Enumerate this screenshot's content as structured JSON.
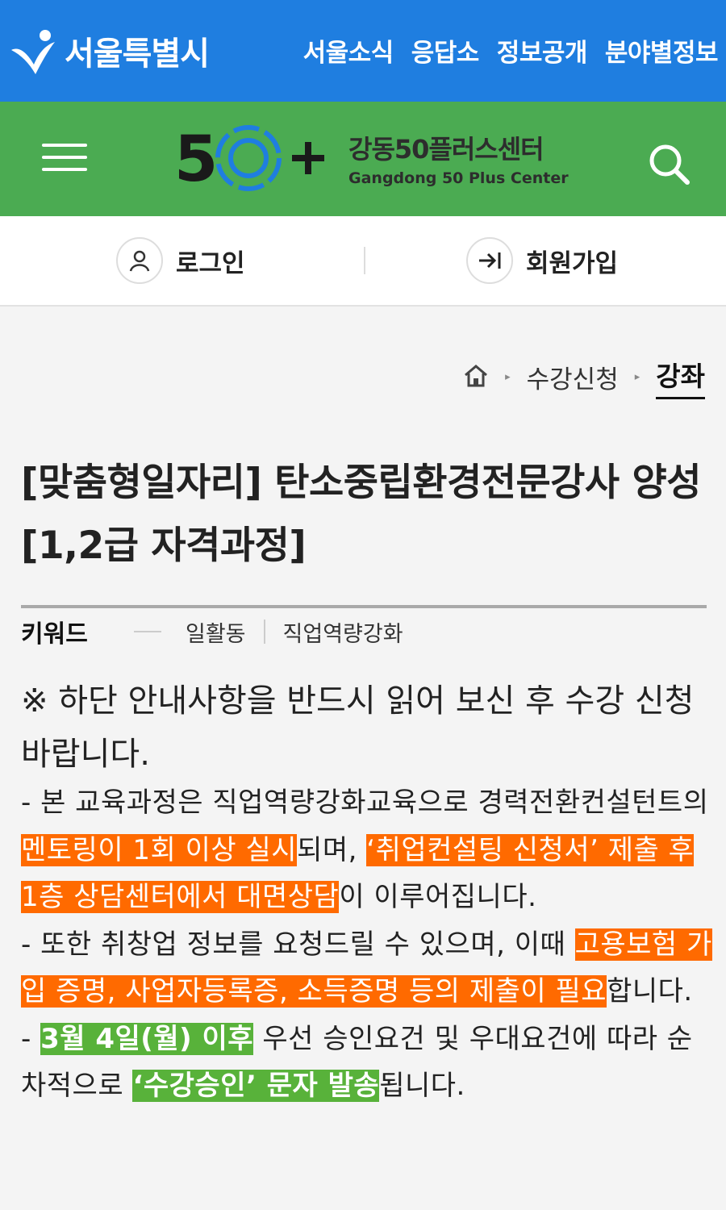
{
  "header": {
    "logo_text": "서울특별시",
    "nav": [
      "서울소식",
      "응답소",
      "정보공개",
      "분야별정보"
    ]
  },
  "center": {
    "brand_number": "5◯+",
    "name_ko": "강동50플러스센터",
    "name_en": "Gangdong 50 Plus Center"
  },
  "auth": {
    "login_label": "로그인",
    "signup_label": "회원가입"
  },
  "breadcrumb": {
    "items": [
      "수강신청",
      "강좌"
    ]
  },
  "page": {
    "title": "[맞춤형일자리] 탄소중립환경전문강사 양성 [1,2급 자격과정]"
  },
  "keywords": {
    "label": "키워드",
    "tags": [
      "일활동",
      "직업역량강화"
    ]
  },
  "notice": {
    "text": "※ 하단 안내사항을 반드시 읽어 보신 후 수강 신청 바랍니다.",
    "p1": {
      "a": "- 본 교육과정은 직업역량강화교육으로 경력전환컨설턴트의 ",
      "hl1": "멘토링이 1회 이상 실시",
      "b": "되며, ",
      "hl2": "‘취업컨설팅 신청서’ 제출 후 1층 상담센터에서 대면상담",
      "c": "이 이루어집니다."
    },
    "p2": {
      "a": "- 또한 취창업 정보를 요청드릴 수 있으며, 이때 ",
      "hl": "고용보험 가입 증명, 사업자등록증, 소득증명 등의 제출이 필요",
      "b": "합니다."
    },
    "p3": {
      "a": "- ",
      "hl1": "3월 4일(월) 이후",
      "b": " 우선 승인요건 및 우대요건에 따라 순차적으로 ",
      "hl2": "‘수강승인’ 문자 발송",
      "c": "됩니다."
    }
  },
  "colors": {
    "top_bar": "#1f7ee0",
    "green_bar": "#4bab52",
    "highlight_orange": "#ff6a00",
    "highlight_green": "#58b23a"
  },
  "icons": [
    "seoul-logo-icon",
    "menu-icon",
    "search-icon",
    "user-icon",
    "signin-arrow-icon",
    "home-icon"
  ]
}
